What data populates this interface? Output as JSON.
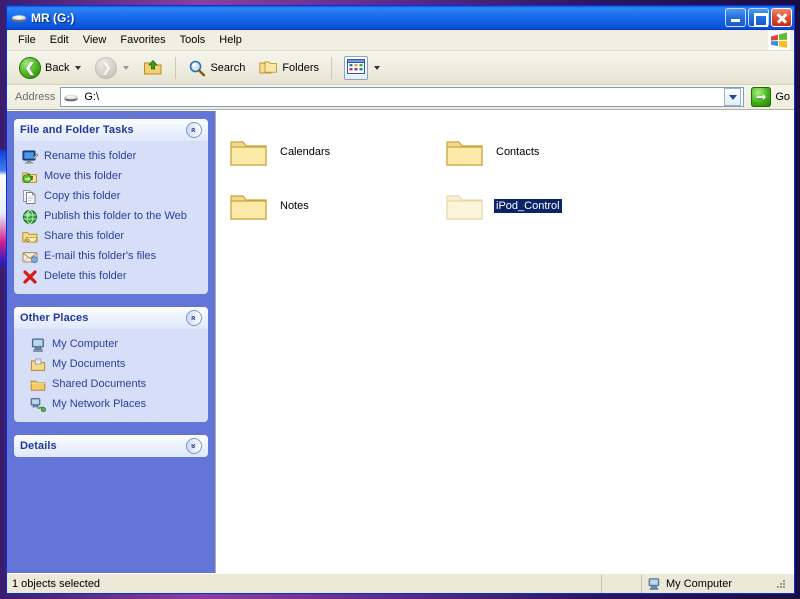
{
  "window": {
    "title": "MR (G:)",
    "title_icon": "removable-drive-icon",
    "controls": {
      "minimize": "Minimize",
      "maximize": "Maximize",
      "close": "Close"
    }
  },
  "menubar": {
    "items": [
      {
        "label": "File"
      },
      {
        "label": "Edit"
      },
      {
        "label": "View"
      },
      {
        "label": "Favorites"
      },
      {
        "label": "Tools"
      },
      {
        "label": "Help"
      }
    ],
    "logo": "windows-flag-icon"
  },
  "toolbar": {
    "back": "Back",
    "forward": "",
    "up": "",
    "search": "Search",
    "folders": "Folders",
    "views": ""
  },
  "address": {
    "label": "Address",
    "value": "G:\\",
    "icon": "removable-drive-icon",
    "go": "Go"
  },
  "sidebar": {
    "panels": [
      {
        "title": "File and Folder Tasks",
        "collapsed": false,
        "chevron": "«",
        "items": [
          {
            "label": "Rename this folder",
            "icon": "rename-icon"
          },
          {
            "label": "Move this folder",
            "icon": "move-icon"
          },
          {
            "label": "Copy this folder",
            "icon": "copy-icon"
          },
          {
            "label": "Publish this folder to the Web",
            "icon": "publish-web-icon"
          },
          {
            "label": "Share this folder",
            "icon": "share-icon"
          },
          {
            "label": "E-mail this folder's files",
            "icon": "email-icon"
          },
          {
            "label": "Delete this folder",
            "icon": "delete-icon"
          }
        ]
      },
      {
        "title": "Other Places",
        "collapsed": false,
        "chevron": "«",
        "items": [
          {
            "label": "My Computer",
            "icon": "my-computer-icon"
          },
          {
            "label": "My Documents",
            "icon": "my-documents-icon"
          },
          {
            "label": "Shared Documents",
            "icon": "shared-documents-icon"
          },
          {
            "label": "My Network Places",
            "icon": "network-places-icon"
          }
        ]
      },
      {
        "title": "Details",
        "collapsed": true,
        "chevron": "»",
        "items": []
      }
    ]
  },
  "content": {
    "items": [
      {
        "label": "Calendars",
        "icon": "folder-icon",
        "selected": false,
        "hidden": false
      },
      {
        "label": "Contacts",
        "icon": "folder-icon",
        "selected": false,
        "hidden": false
      },
      {
        "label": "Notes",
        "icon": "folder-icon",
        "selected": false,
        "hidden": false
      },
      {
        "label": "iPod_Control",
        "icon": "folder-icon",
        "selected": true,
        "hidden": true
      }
    ]
  },
  "statusbar": {
    "left": "1 objects selected",
    "middle": "",
    "right": "My Computer",
    "right_icon": "my-computer-icon"
  },
  "colors": {
    "titlebar_blue": "#0a55dc",
    "sidebar_blue": "#6375d6",
    "panel_body": "#d6dff7",
    "link_blue": "#2b3e9e",
    "selection": "#0a246a",
    "folder_yellow": "#fbe08a"
  }
}
